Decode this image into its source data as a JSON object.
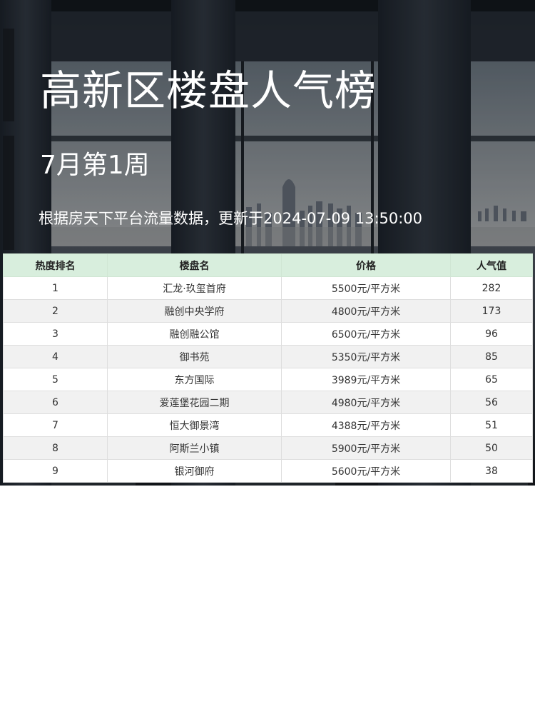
{
  "poster": {
    "title": "高新区楼盘人气榜",
    "subtitle": "7月第1周",
    "note": "根据房天下平台流量数据，更新于2024-07-09 13:50:00"
  },
  "table": {
    "headers": [
      "热度排名",
      "楼盘名",
      "价格",
      "人气值"
    ],
    "rows": [
      [
        "1",
        "汇龙·玖玺首府",
        "5500元/平方米",
        "282"
      ],
      [
        "2",
        "融创中央学府",
        "4800元/平方米",
        "173"
      ],
      [
        "3",
        "融创融公馆",
        "6500元/平方米",
        "96"
      ],
      [
        "4",
        "御书苑",
        "5350元/平方米",
        "85"
      ],
      [
        "5",
        "东方国际",
        "3989元/平方米",
        "65"
      ],
      [
        "6",
        "爱莲堡花园二期",
        "4980元/平方米",
        "56"
      ],
      [
        "7",
        "恒大御景湾",
        "4388元/平方米",
        "51"
      ],
      [
        "8",
        "阿斯兰小镇",
        "5900元/平方米",
        "50"
      ],
      [
        "9",
        "银河御府",
        "5600元/平方米",
        "38"
      ]
    ]
  },
  "colors": {
    "header_bg": "#d8eedd",
    "row_alt_bg": "#f1f1f1",
    "title_text": "#ffffff"
  }
}
